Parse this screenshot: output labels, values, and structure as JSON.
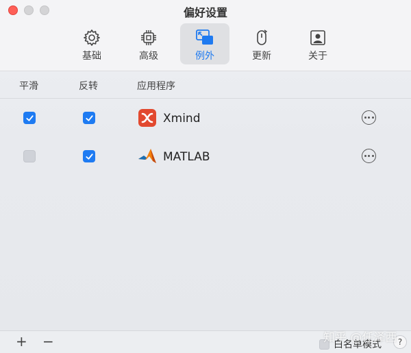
{
  "window": {
    "title": "偏好设置"
  },
  "tabs": [
    {
      "label": "基础",
      "icon": "gear-icon",
      "active": false
    },
    {
      "label": "高级",
      "icon": "chip-icon",
      "active": false
    },
    {
      "label": "例外",
      "icon": "windows-icon",
      "active": true
    },
    {
      "label": "更新",
      "icon": "update-icon",
      "active": false
    },
    {
      "label": "关于",
      "icon": "person-card-icon",
      "active": false
    }
  ],
  "table": {
    "headers": [
      "平滑",
      "反转",
      "应用程序"
    ],
    "rows": [
      {
        "smooth": true,
        "reverse": true,
        "app": "Xmind",
        "icon": "xmind-icon"
      },
      {
        "smooth": false,
        "reverse": true,
        "app": "MATLAB",
        "icon": "matlab-icon"
      }
    ]
  },
  "footer": {
    "add": "+",
    "remove": "−",
    "whitelist_label": "白名单模式",
    "help": "?"
  },
  "watermark": "知乎 @任泽西",
  "colors": {
    "accent": "#1e7bf2",
    "close": "#fe5f57"
  }
}
